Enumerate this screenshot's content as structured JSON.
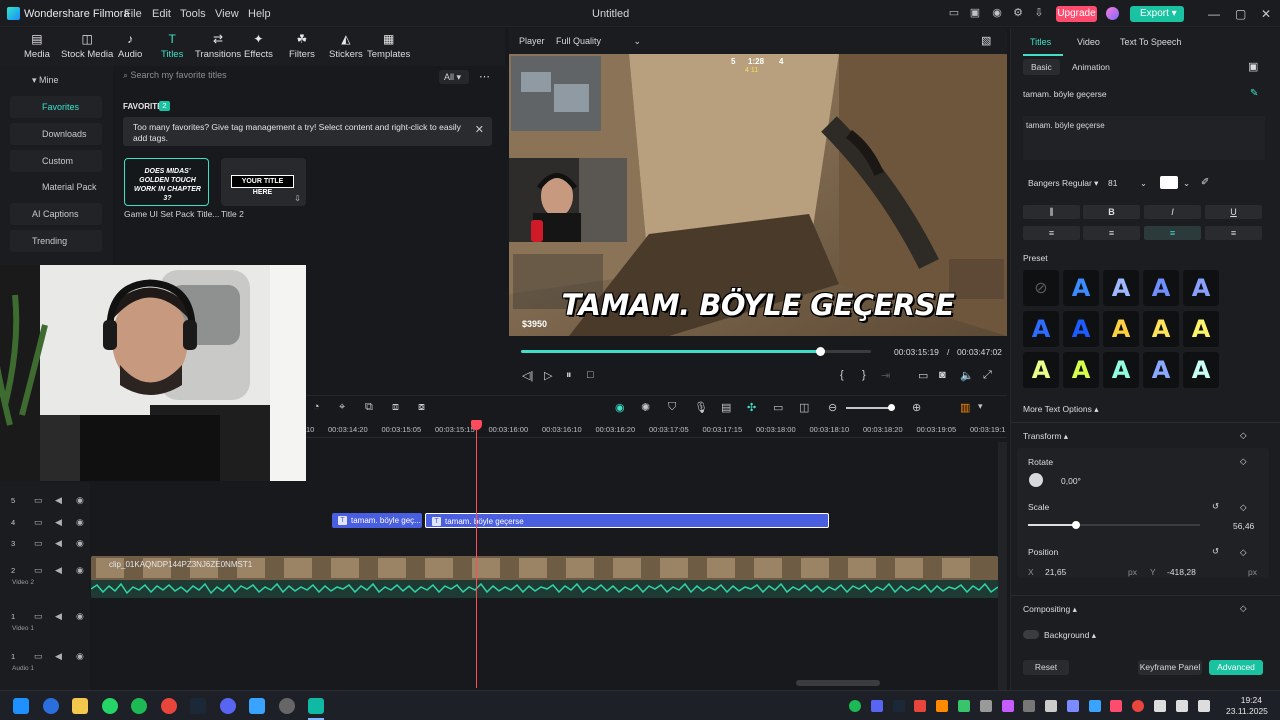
{
  "app": {
    "name": "Wondershare Filmora",
    "doc_title": "Untitled",
    "menus": [
      "File",
      "Edit",
      "Tools",
      "View",
      "Help"
    ],
    "upgrade_label": "Upgrade",
    "export_label": "Export",
    "accent": "#3fe0c7"
  },
  "media_toolbar": {
    "items": [
      {
        "label": "Media",
        "icon": "media-icon"
      },
      {
        "label": "Stock Media",
        "icon": "stock-media-icon"
      },
      {
        "label": "Audio",
        "icon": "audio-icon"
      },
      {
        "label": "Titles",
        "icon": "titles-icon",
        "active": true
      },
      {
        "label": "Transitions",
        "icon": "transitions-icon"
      },
      {
        "label": "Effects",
        "icon": "effects-icon"
      },
      {
        "label": "Filters",
        "icon": "filters-icon"
      },
      {
        "label": "Stickers",
        "icon": "stickers-icon"
      },
      {
        "label": "Templates",
        "icon": "templates-icon"
      }
    ]
  },
  "sidebar": {
    "items": [
      "Mine",
      "Favorites",
      "Downloads",
      "Custom",
      "Material Pack",
      "AI Captions",
      "Trending"
    ]
  },
  "browse": {
    "search_placeholder": "Search my favorite titles",
    "filter": "All",
    "favorites_label": "FAVORITES",
    "favorites_count": "2",
    "notice": "Too many favorites? Give tag management a try! Select content and right-click to easily add tags.",
    "cards": [
      {
        "thumb_text": "DOES MIDAS' GOLDEN TOUCH WORK IN CHAPTER 3?",
        "label": "Game UI Set Pack Title..."
      },
      {
        "thumb_text": "YOUR TITLE HERE",
        "label": "Title 2"
      }
    ]
  },
  "player": {
    "label": "Player",
    "quality": "Full Quality",
    "caption": "TAMAM. BÖYLE GEÇERSE",
    "money": "$3950",
    "hud_round": "1:28",
    "hud_left": "5",
    "hud_right": "4",
    "hud_sub": "4  11",
    "current_time": "00:03:15:19",
    "total_time": "00:03:47:02",
    "progress": 0.855
  },
  "props": {
    "tabs": [
      "Titles",
      "Video",
      "Text To Speech"
    ],
    "subtabs": [
      "Basic",
      "Animation"
    ],
    "title_name": "tamam. böyle geçerse",
    "text_value": "tamam. böyle geçerse",
    "font": "Bangers Regular",
    "font_size": "81",
    "format": [
      "B",
      "I",
      "U"
    ],
    "preset_label": "Preset",
    "more_text_options": "More Text Options",
    "transform": "Transform",
    "rotate_label": "Rotate",
    "rotate_value": "0,00°",
    "scale_label": "Scale",
    "scale_value": "56,46",
    "scale_fraction": 0.56,
    "position_label": "Position",
    "pos_x_label": "X",
    "pos_x": "21,65",
    "pos_y_label": "Y",
    "pos_y": "-418,28",
    "unit": "px",
    "compositing": "Compositing",
    "background": "Background",
    "reset": "Reset",
    "keyframe": "Keyframe Panel",
    "advanced": "Advanced",
    "presets": [
      {
        "color": "#5a5a5a"
      },
      {
        "color": "#3a8cff"
      },
      {
        "color": "#9fb8ff"
      },
      {
        "color": "#6f8fff"
      },
      {
        "color": "#8aa0ff"
      },
      {
        "color": "#2e6bff"
      },
      {
        "color": "#1d5cff"
      },
      {
        "color": "#ffd040"
      },
      {
        "color": "#ffe35a"
      },
      {
        "color": "#fff36b"
      },
      {
        "color": "#e8ff8a"
      },
      {
        "color": "#d8ff4a"
      },
      {
        "color": "#8fffe0"
      },
      {
        "color": "#8aa8ff"
      },
      {
        "color": "#c8fff4"
      }
    ]
  },
  "timeline": {
    "ticks": [
      "10",
      "00:03:14:20",
      "00:03:15:05",
      "00:03:15:15",
      "00:03:16:00",
      "00:03:16:10",
      "00:03:16:20",
      "00:03:17:05",
      "00:03:17:15",
      "00:03:18:00",
      "00:03:18:10",
      "00:03:18:20",
      "00:03:19:05",
      "00:03:19:1"
    ],
    "tracks": [
      {
        "num": "5",
        "name": ""
      },
      {
        "num": "4",
        "name": ""
      },
      {
        "num": "3",
        "name": ""
      },
      {
        "num": "2",
        "name": "Video 2"
      },
      {
        "num": "1",
        "name": "Video 1"
      },
      {
        "num": "1",
        "name": "Audio 1"
      }
    ],
    "clip_a": "tamam. böyle geç...",
    "clip_b": "tamam. böyle geçerse",
    "video_clip": "clip_01KAQNDP144PZ3NJ6ZE0NMST1"
  },
  "taskbar": {
    "time": "19:24",
    "date": "23.11.2025"
  }
}
